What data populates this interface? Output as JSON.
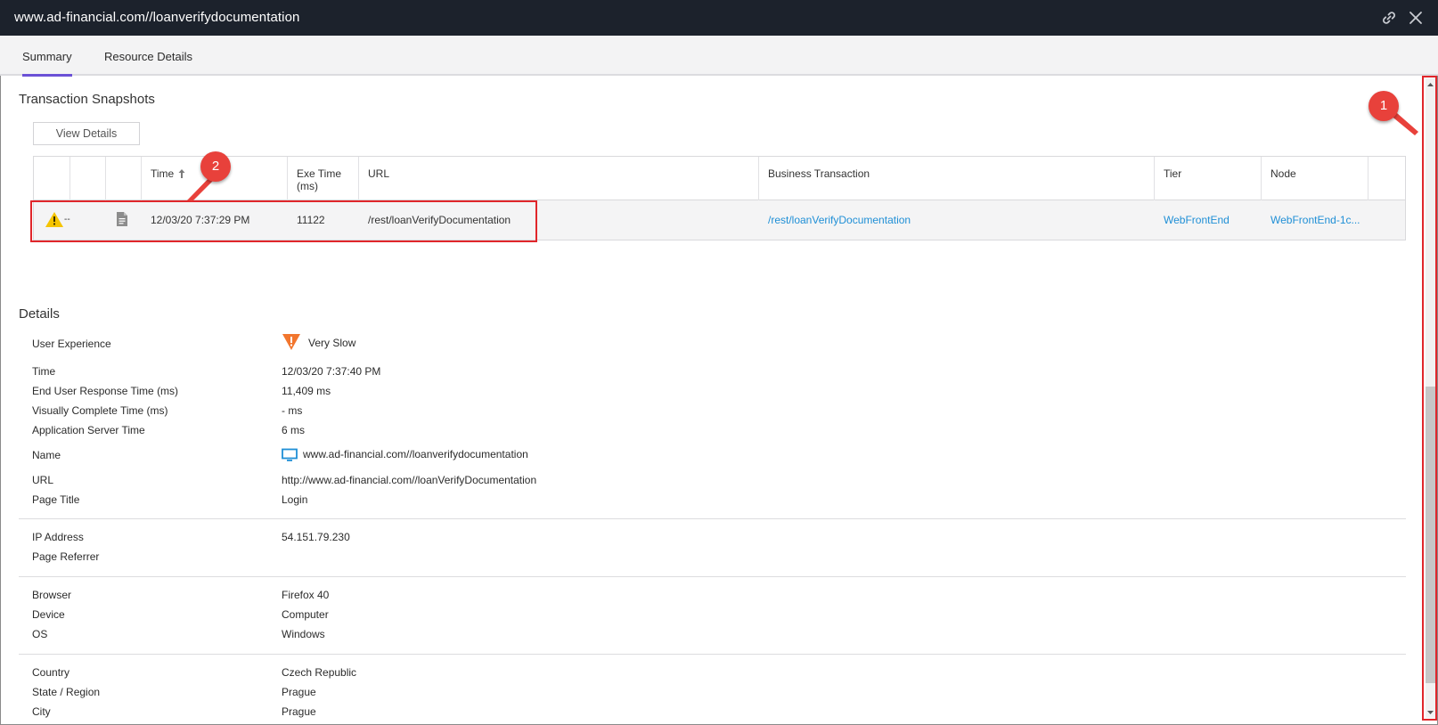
{
  "window": {
    "title": "www.ad-financial.com//loanverifydocumentation",
    "link_icon": "link-icon",
    "close_icon": "close-icon"
  },
  "tabs": [
    {
      "label": "Summary",
      "active": true
    },
    {
      "label": "Resource Details",
      "active": false
    }
  ],
  "snapshots": {
    "title": "Transaction Snapshots",
    "view_details_label": "View Details",
    "columns": {
      "time": "Time",
      "exe_time": "Exe Time\n(ms)",
      "url": "URL",
      "business_transaction": "Business Transaction",
      "tier": "Tier",
      "node": "Node"
    },
    "rows": [
      {
        "status_icon": "warning-icon",
        "status_text": "--",
        "doc_icon": "document-icon",
        "time": "12/03/20 7:37:29 PM",
        "exe_time": "11122",
        "url": "/rest/loanVerifyDocumentation",
        "business_transaction": "/rest/loanVerifyDocumentation",
        "tier": "WebFrontEnd",
        "node": "WebFrontEnd-1c..."
      }
    ]
  },
  "details": {
    "title": "Details",
    "fields": {
      "user_experience": {
        "label": "User Experience",
        "value": "Very Slow",
        "icon": "very-slow-icon"
      },
      "time": {
        "label": "Time",
        "value": "12/03/20 7:37:40 PM"
      },
      "end_user_response": {
        "label": "End User Response Time (ms)",
        "value": "11,409 ms"
      },
      "visually_complete": {
        "label": "Visually Complete Time (ms)",
        "value": "- ms"
      },
      "app_server_time": {
        "label": "Application Server Time",
        "value": "6 ms"
      },
      "name": {
        "label": "Name",
        "value": "www.ad-financial.com//loanverifydocumentation",
        "icon": "monitor-icon"
      },
      "url": {
        "label": "URL",
        "value": "http://www.ad-financial.com//loanVerifyDocumentation"
      },
      "page_title": {
        "label": "Page Title",
        "value": "Login"
      },
      "ip_address": {
        "label": "IP Address",
        "value": "54.151.79.230"
      },
      "page_referrer": {
        "label": "Page Referrer",
        "value": ""
      },
      "browser": {
        "label": "Browser",
        "value": "Firefox 40"
      },
      "device": {
        "label": "Device",
        "value": "Computer"
      },
      "os": {
        "label": "OS",
        "value": "Windows"
      },
      "country": {
        "label": "Country",
        "value": "Czech Republic"
      },
      "state_region": {
        "label": "State / Region",
        "value": "Prague"
      },
      "city": {
        "label": "City",
        "value": "Prague"
      }
    }
  },
  "annotations": {
    "badge_1": "1",
    "badge_2": "2"
  },
  "colors": {
    "titlebar_bg": "#1c222c",
    "tab_accent": "#6b51d6",
    "link": "#1f8fd6",
    "annotation_red": "#e0262b",
    "warning_yellow": "#f5c400",
    "very_slow_orange": "#f2762e"
  }
}
